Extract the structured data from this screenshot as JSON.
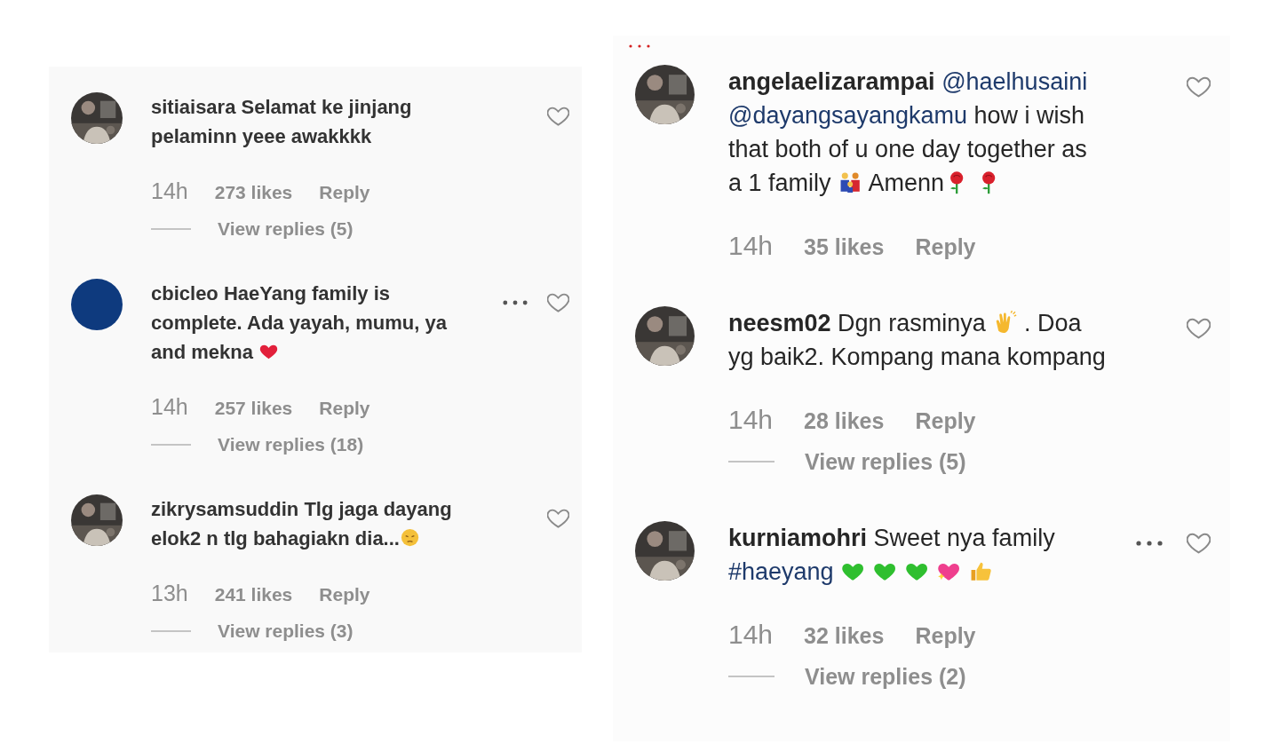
{
  "panels": [
    {
      "kind": "compact",
      "comments": [
        {
          "username": "sitiaisara",
          "avatar": {
            "kind": "picture"
          },
          "parts": [
            {
              "kind": "text",
              "text": "Selamat ke jinjang\npelaminn yeee awakkkk"
            }
          ],
          "time": "14h",
          "likes": "273 likes",
          "reply": "Reply",
          "view_replies": "View replies (5)",
          "more": false,
          "liked": false
        },
        {
          "username": "cbicleo",
          "avatar": {
            "kind": "plain",
            "color": "#0e3a7e"
          },
          "parts": [
            {
              "kind": "text",
              "text": "HaeYang family is\ncomplete. Ada yayah, mumu, ya\nand mekna "
            },
            {
              "kind": "redheart"
            }
          ],
          "time": "14h",
          "likes": "257 likes",
          "reply": "Reply",
          "view_replies": "View replies (18)",
          "more": true,
          "liked": false
        },
        {
          "username": "zikrysamsuddin",
          "avatar": {
            "kind": "picture"
          },
          "parts": [
            {
              "kind": "text",
              "text": "Tlg jaga dayang\nelok2 n tlg bahagiakn dia..."
            },
            {
              "kind": "pensive"
            }
          ],
          "time": "13h",
          "likes": "241 likes",
          "reply": "Reply",
          "view_replies": "View replies (3)",
          "more": false,
          "liked": false
        }
      ]
    },
    {
      "kind": "large",
      "comments": [
        {
          "username": "angelaelizarampai",
          "avatar": {
            "kind": "picture"
          },
          "parts": [
            {
              "kind": "mention",
              "text": "@haelhusaini"
            },
            {
              "kind": "break"
            },
            {
              "kind": "mention",
              "text": "@dayangsayangkamu"
            },
            {
              "kind": "text",
              "text": " how i wish\nthat both of u one day together as\na 1 family "
            },
            {
              "kind": "family"
            },
            {
              "kind": "text",
              "text": "  Amenn"
            },
            {
              "kind": "rose"
            },
            {
              "kind": "space"
            },
            {
              "kind": "rose"
            }
          ],
          "time": "14h",
          "likes": "35 likes",
          "reply": "Reply",
          "more": false,
          "liked": false
        },
        {
          "username": "neesm02",
          "avatar": {
            "kind": "picture"
          },
          "parts": [
            {
              "kind": "text",
              "text": "Dgn rasminya "
            },
            {
              "kind": "clap"
            },
            {
              "kind": "text",
              "text": " . Doa\nyg baik2. Kompang mana kompang"
            }
          ],
          "time": "14h",
          "likes": "28 likes",
          "reply": "Reply",
          "view_replies": "View replies (5)",
          "more": false,
          "liked": false
        },
        {
          "username": "kurniamohri",
          "avatar": {
            "kind": "picture"
          },
          "parts": [
            {
              "kind": "text",
              "text": "Sweet nya family\n"
            },
            {
              "kind": "mention",
              "text": "#haeyang"
            },
            {
              "kind": "space"
            },
            {
              "kind": "greenheart"
            },
            {
              "kind": "space"
            },
            {
              "kind": "greenheart"
            },
            {
              "kind": "space"
            },
            {
              "kind": "greenheart"
            },
            {
              "kind": "space"
            },
            {
              "kind": "sparkleheart"
            },
            {
              "kind": "space"
            },
            {
              "kind": "thumbsup"
            }
          ],
          "time": "14h",
          "likes": "32 likes",
          "reply": "Reply",
          "view_replies": "View replies (2)",
          "more": true,
          "liked": false
        }
      ]
    }
  ]
}
